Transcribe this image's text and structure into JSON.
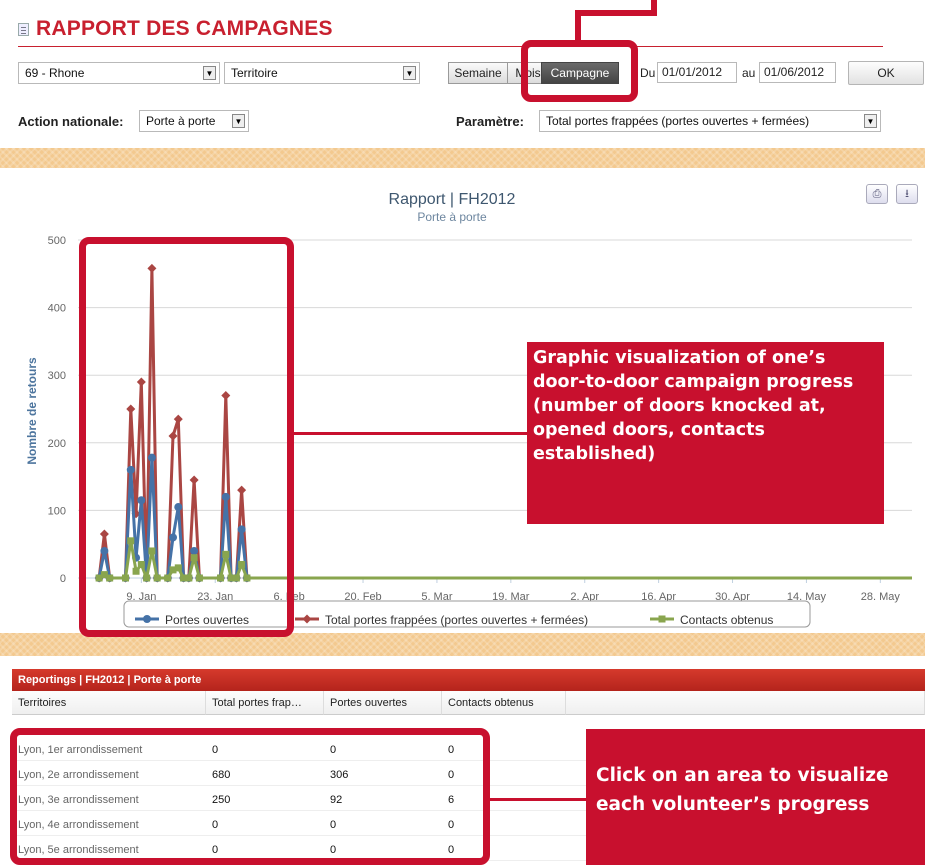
{
  "header": {
    "title": "RAPPORT DES CAMPAGNES"
  },
  "filters": {
    "department": "69 - Rhone",
    "scope": "Territoire",
    "period_tabs": [
      {
        "label": "Semaine",
        "active": false
      },
      {
        "label": "Mois",
        "active": false
      },
      {
        "label": "Campagne",
        "active": true
      }
    ],
    "from_label": "Du",
    "from_date": "01/01/2012",
    "to_label": "au",
    "to_date": "01/06/2012",
    "ok_label": "OK",
    "action_label": "Action nationale:",
    "action_value": "Porte à porte",
    "param_label": "Paramètre:",
    "param_value": "Total portes frappées (portes ouvertes + fermées)"
  },
  "chart_toolbar": {
    "print_icon": "printer-icon",
    "download_icon": "download-icon"
  },
  "chart_data": {
    "type": "line",
    "title": "Rapport | FH2012",
    "subtitle": "Porte à porte",
    "ylabel": "Nombre de retours",
    "xlabel": "",
    "ylim": [
      0,
      500
    ],
    "yticks": [
      0,
      100,
      200,
      300,
      400,
      500
    ],
    "xlim": [
      "2011-12-28",
      "2012-06-03"
    ],
    "xticks": [
      {
        "label": "9. Jan",
        "date": "2012-01-09"
      },
      {
        "label": "23. Jan",
        "date": "2012-01-23"
      },
      {
        "label": "6. Feb",
        "date": "2012-02-06"
      },
      {
        "label": "20. Feb",
        "date": "2012-02-20"
      },
      {
        "label": "5. Mar",
        "date": "2012-03-05"
      },
      {
        "label": "19. Mar",
        "date": "2012-03-19"
      },
      {
        "label": "2. Apr",
        "date": "2012-04-02"
      },
      {
        "label": "16. Apr",
        "date": "2012-04-16"
      },
      {
        "label": "30. Apr",
        "date": "2012-04-30"
      },
      {
        "label": "14. May",
        "date": "2012-05-14"
      },
      {
        "label": "28. May",
        "date": "2012-05-28"
      }
    ],
    "grid": true,
    "legend": "bottom",
    "series": [
      {
        "name": "Portes ouvertes",
        "color": "#4572a7",
        "marker": "circle",
        "points": [
          [
            "2012-01-01",
            0
          ],
          [
            "2012-01-02",
            40
          ],
          [
            "2012-01-03",
            0
          ],
          [
            "2012-01-06",
            0
          ],
          [
            "2012-01-07",
            160
          ],
          [
            "2012-01-08",
            30
          ],
          [
            "2012-01-09",
            115
          ],
          [
            "2012-01-10",
            0
          ],
          [
            "2012-01-11",
            178
          ],
          [
            "2012-01-12",
            0
          ],
          [
            "2012-01-14",
            0
          ],
          [
            "2012-01-15",
            60
          ],
          [
            "2012-01-16",
            105
          ],
          [
            "2012-01-17",
            0
          ],
          [
            "2012-01-18",
            0
          ],
          [
            "2012-01-19",
            40
          ],
          [
            "2012-01-20",
            0
          ],
          [
            "2012-01-24",
            0
          ],
          [
            "2012-01-25",
            120
          ],
          [
            "2012-01-26",
            0
          ],
          [
            "2012-01-27",
            0
          ],
          [
            "2012-01-28",
            72
          ],
          [
            "2012-01-29",
            0
          ],
          [
            "2012-02-07",
            0
          ],
          [
            "2012-06-03",
            0
          ]
        ]
      },
      {
        "name": "Total portes frappées (portes ouvertes + fermées)",
        "color": "#aa4643",
        "marker": "diamond",
        "points": [
          [
            "2012-01-01",
            0
          ],
          [
            "2012-01-02",
            65
          ],
          [
            "2012-01-03",
            0
          ],
          [
            "2012-01-06",
            0
          ],
          [
            "2012-01-07",
            250
          ],
          [
            "2012-01-08",
            95
          ],
          [
            "2012-01-09",
            290
          ],
          [
            "2012-01-10",
            0
          ],
          [
            "2012-01-11",
            458
          ],
          [
            "2012-01-12",
            0
          ],
          [
            "2012-01-14",
            0
          ],
          [
            "2012-01-15",
            210
          ],
          [
            "2012-01-16",
            235
          ],
          [
            "2012-01-17",
            0
          ],
          [
            "2012-01-18",
            0
          ],
          [
            "2012-01-19",
            145
          ],
          [
            "2012-01-20",
            0
          ],
          [
            "2012-01-24",
            0
          ],
          [
            "2012-01-25",
            270
          ],
          [
            "2012-01-26",
            0
          ],
          [
            "2012-01-27",
            0
          ],
          [
            "2012-01-28",
            130
          ],
          [
            "2012-01-29",
            0
          ],
          [
            "2012-02-07",
            0
          ],
          [
            "2012-06-03",
            0
          ]
        ]
      },
      {
        "name": "Contacts obtenus",
        "color": "#89a54e",
        "marker": "square",
        "points": [
          [
            "2012-01-01",
            0
          ],
          [
            "2012-01-02",
            5
          ],
          [
            "2012-01-03",
            0
          ],
          [
            "2012-01-06",
            0
          ],
          [
            "2012-01-07",
            55
          ],
          [
            "2012-01-08",
            10
          ],
          [
            "2012-01-09",
            20
          ],
          [
            "2012-01-10",
            0
          ],
          [
            "2012-01-11",
            40
          ],
          [
            "2012-01-12",
            0
          ],
          [
            "2012-01-14",
            0
          ],
          [
            "2012-01-15",
            12
          ],
          [
            "2012-01-16",
            15
          ],
          [
            "2012-01-17",
            0
          ],
          [
            "2012-01-18",
            0
          ],
          [
            "2012-01-19",
            30
          ],
          [
            "2012-01-20",
            0
          ],
          [
            "2012-01-24",
            0
          ],
          [
            "2012-01-25",
            35
          ],
          [
            "2012-01-26",
            0
          ],
          [
            "2012-01-27",
            0
          ],
          [
            "2012-01-28",
            20
          ],
          [
            "2012-01-29",
            0
          ],
          [
            "2012-02-07",
            0
          ],
          [
            "2012-06-03",
            0
          ]
        ]
      }
    ]
  },
  "callouts": {
    "chart_text": " Graphic visualization of one’s door-to-door campaign progress (number of doors knocked at, opened doors, contacts established)",
    "table_text": "Click on an area to visualize each volunteer’s progress"
  },
  "table": {
    "title": "Reportings | FH2012 | Porte à porte",
    "columns": [
      "Territoires",
      "Total portes frap…",
      "Portes ouvertes",
      "Contacts obtenus"
    ],
    "rows": [
      [
        "Lyon, 1er arrondissement",
        "0",
        "0",
        "0"
      ],
      [
        "Lyon, 2e arrondissement",
        "680",
        "306",
        "0"
      ],
      [
        "Lyon, 3e arrondissement",
        "250",
        "92",
        "6"
      ],
      [
        "Lyon, 4e arrondissement",
        "0",
        "0",
        "0"
      ],
      [
        "Lyon, 5e arrondissement",
        "0",
        "0",
        "0"
      ]
    ]
  },
  "colors": {
    "accent_red": "#c8102e",
    "title_red": "#c8202f",
    "background": "#f3c98f"
  }
}
